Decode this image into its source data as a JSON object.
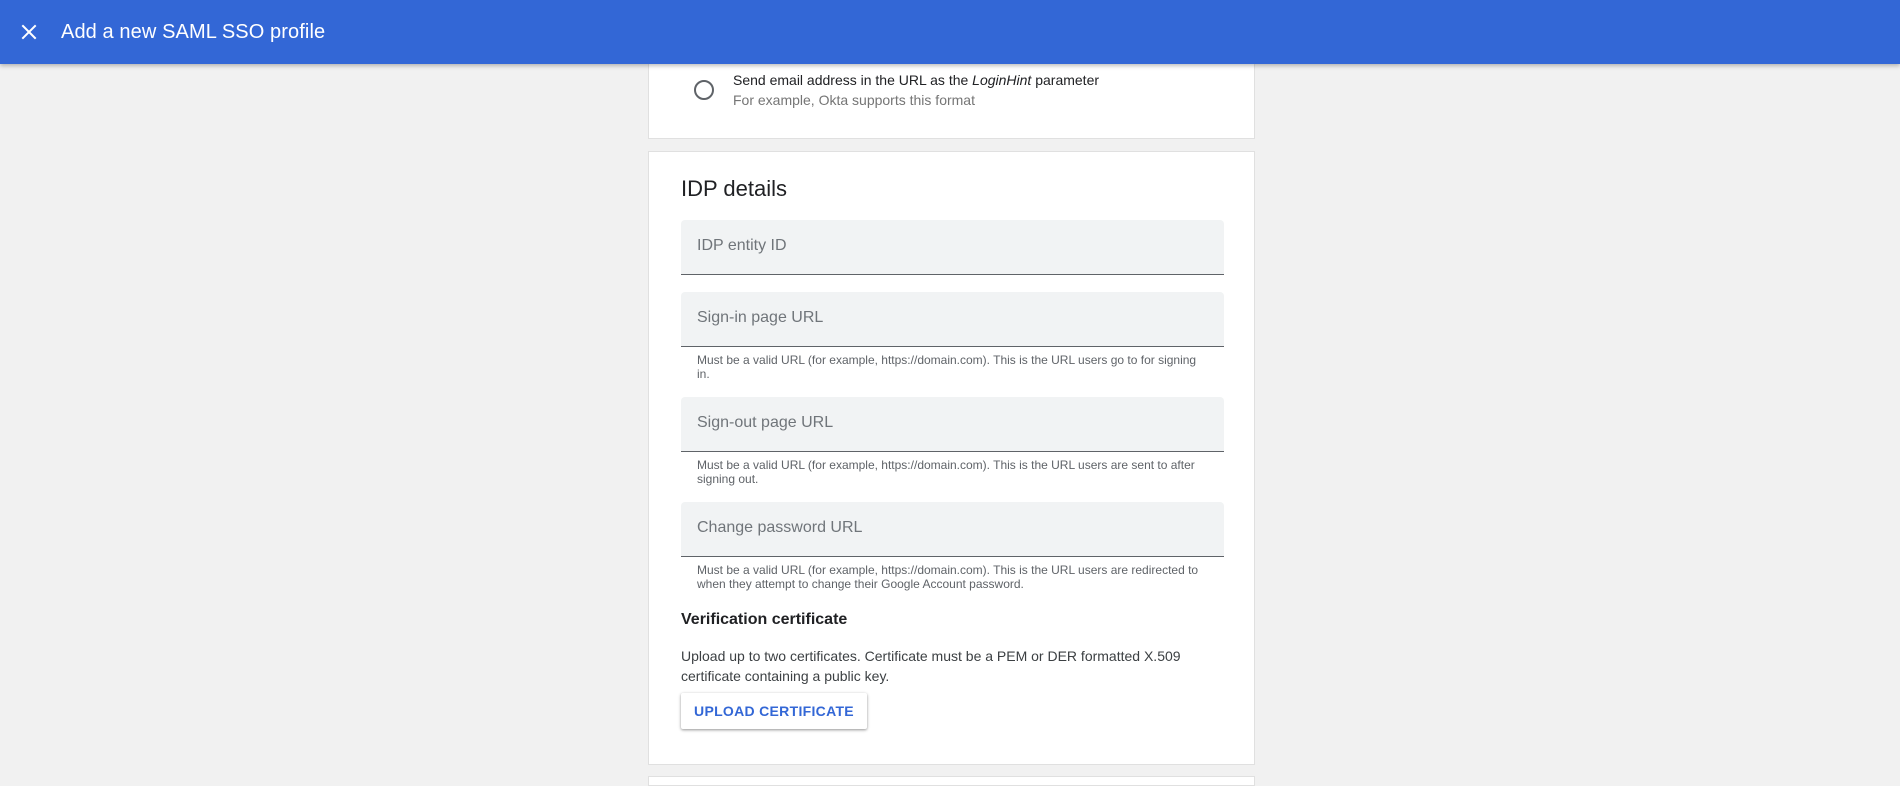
{
  "header": {
    "title": "Add a new SAML SSO profile",
    "close_icon": "close-icon",
    "bg_color": "#3367d6"
  },
  "radio_option": {
    "label_prefix": "Send email address in the URL as the ",
    "label_italic": "LoginHint",
    "label_suffix": " parameter",
    "sublabel": "For example, Okta supports this format",
    "selected": false
  },
  "idp_details": {
    "title": "IDP details",
    "fields": [
      {
        "label": "IDP entity ID",
        "value": "",
        "helper": ""
      },
      {
        "label": "Sign-in page URL",
        "value": "",
        "helper": "Must be a valid URL (for example, https://domain.com). This is the URL users go to for signing in."
      },
      {
        "label": "Sign-out page URL",
        "value": "",
        "helper": "Must be a valid URL (for example, https://domain.com). This is the URL users are sent to after signing out."
      },
      {
        "label": "Change password URL",
        "value": "",
        "helper": "Must be a valid URL (for example, https://domain.com). This is the URL users are redirected to when they attempt to change their Google Account password."
      }
    ],
    "verification": {
      "heading": "Verification certificate",
      "description": "Upload up to two certificates. Certificate must be a PEM or DER formatted X.509 certificate containing a public key.",
      "button_label": "UPLOAD CERTIFICATE"
    }
  },
  "colors": {
    "accent": "#3367d6",
    "page_bg": "#f1f1f1"
  }
}
